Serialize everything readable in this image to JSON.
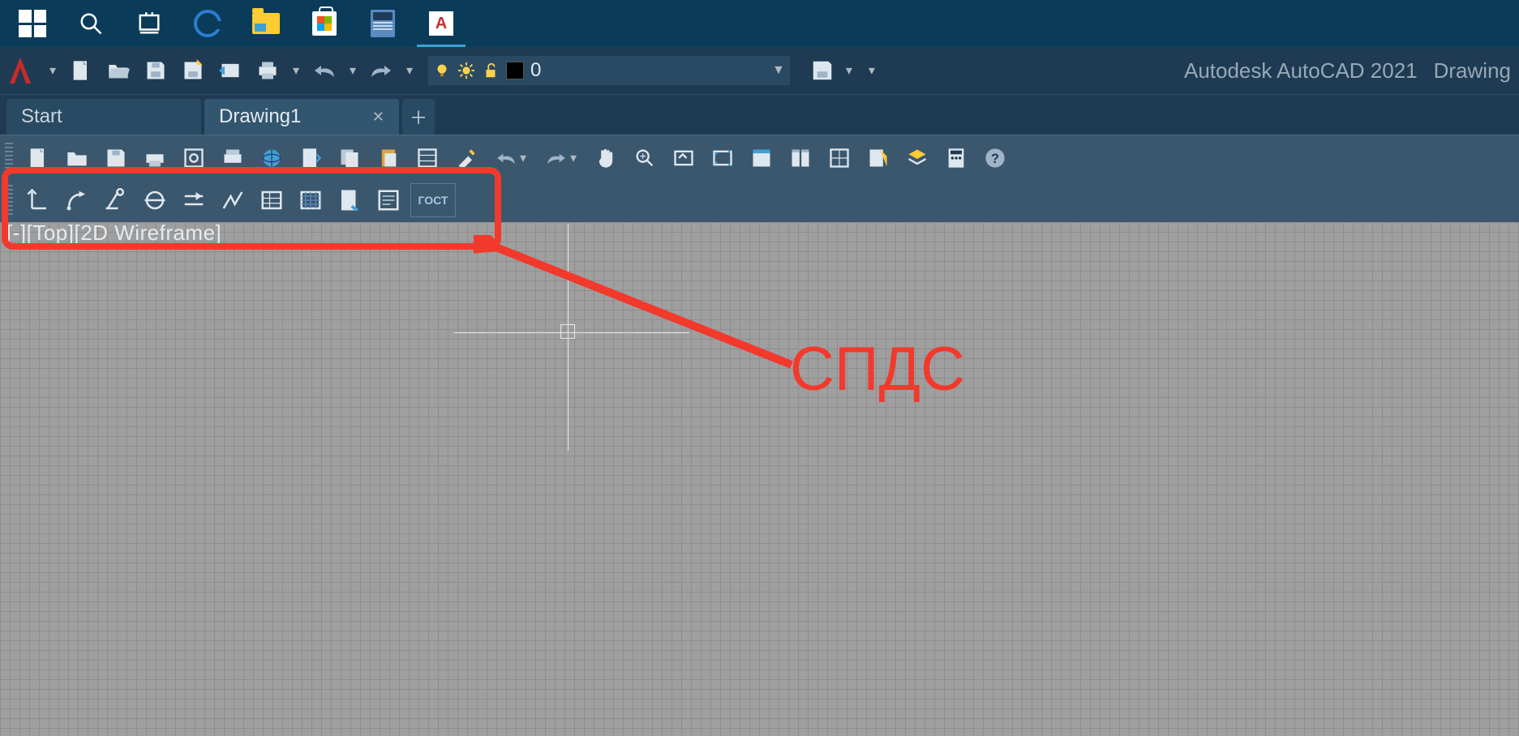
{
  "taskbar": {
    "items": [
      {
        "name": "win-start-button"
      },
      {
        "name": "win-search-button"
      },
      {
        "name": "win-task-view-button"
      },
      {
        "name": "edge-browser"
      },
      {
        "name": "file-explorer"
      },
      {
        "name": "ms-store"
      },
      {
        "name": "calculator"
      },
      {
        "name": "autocad-app",
        "active": true
      }
    ]
  },
  "titlebar": {
    "app_name": "Autodesk AutoCAD 2021",
    "doc_name": "Drawing",
    "qat": [
      "new-doc",
      "open-doc",
      "save-doc",
      "save-as",
      "open-web",
      "print",
      "undo",
      "redo"
    ],
    "layer": {
      "value": "0",
      "color": "#000000"
    }
  },
  "tabs": {
    "items": [
      {
        "label": "Start",
        "active": false
      },
      {
        "label": "Drawing1",
        "active": true
      }
    ]
  },
  "toolbar1": [
    "new-doc",
    "open-doc",
    "save-doc",
    "print",
    "plot-preview",
    "batch-plot",
    "publish-web",
    "export",
    "copy",
    "paste",
    "properties",
    "match",
    "undo",
    "redo",
    "pan",
    "zoom-realtime",
    "zoom-window",
    "zoom-extents",
    "tool-palette-1",
    "tool-palette-2",
    "tool-palette-3",
    "tool-palette-4",
    "tool-palette-5",
    "calculator",
    "help"
  ],
  "toolbar2": {
    "items": [
      "spds-level-mark",
      "spds-node-mark",
      "spds-axis",
      "spds-break-line",
      "spds-section-mark",
      "spds-welding",
      "spds-table",
      "spds-hatch",
      "spds-format",
      "spds-spec"
    ],
    "gost_label": "ГОСТ"
  },
  "viewport_label": "[-][Top][2D Wireframe]",
  "annotation": {
    "label": "СПДС"
  }
}
